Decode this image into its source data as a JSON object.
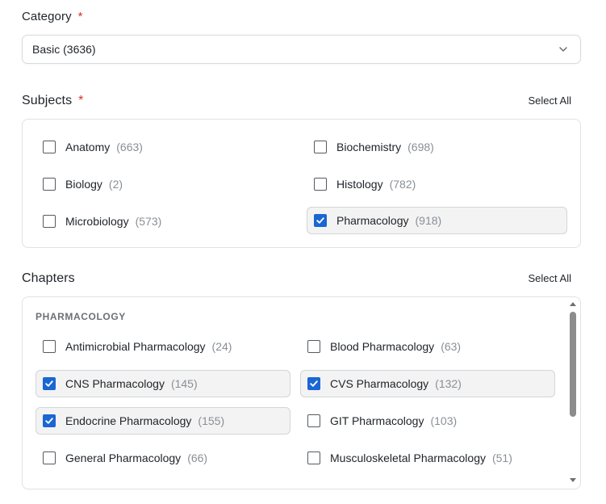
{
  "category": {
    "label": "Category",
    "required_mark": "*",
    "selected": "Basic (3636)",
    "chevron_icon": "chevron-down-icon"
  },
  "subjects": {
    "label": "Subjects",
    "required_mark": "*",
    "select_all": "Select All",
    "items": [
      {
        "name": "Anatomy",
        "count": "(663)",
        "checked": false
      },
      {
        "name": "Biochemistry",
        "count": "(698)",
        "checked": false
      },
      {
        "name": "Biology",
        "count": "(2)",
        "checked": false
      },
      {
        "name": "Histology",
        "count": "(782)",
        "checked": false
      },
      {
        "name": "Microbiology",
        "count": "(573)",
        "checked": false
      },
      {
        "name": "Pharmacology",
        "count": "(918)",
        "checked": true
      }
    ]
  },
  "chapters": {
    "label": "Chapters",
    "select_all": "Select All",
    "group_title": "PHARMACOLOGY",
    "items": [
      {
        "name": "Antimicrobial Pharmacology",
        "count": "(24)",
        "checked": false
      },
      {
        "name": "Blood Pharmacology",
        "count": "(63)",
        "checked": false
      },
      {
        "name": "CNS Pharmacology",
        "count": "(145)",
        "checked": true
      },
      {
        "name": "CVS Pharmacology",
        "count": "(132)",
        "checked": true
      },
      {
        "name": "Endocrine Pharmacology",
        "count": "(155)",
        "checked": true
      },
      {
        "name": "GIT Pharmacology",
        "count": "(103)",
        "checked": false
      },
      {
        "name": "General Pharmacology",
        "count": "(66)",
        "checked": false
      },
      {
        "name": "Musculoskeletal Pharmacology",
        "count": "(51)",
        "checked": false
      }
    ]
  },
  "colors": {
    "accent": "#1a66d2",
    "required": "#d93025",
    "checked_bg": "#f3f3f3"
  }
}
